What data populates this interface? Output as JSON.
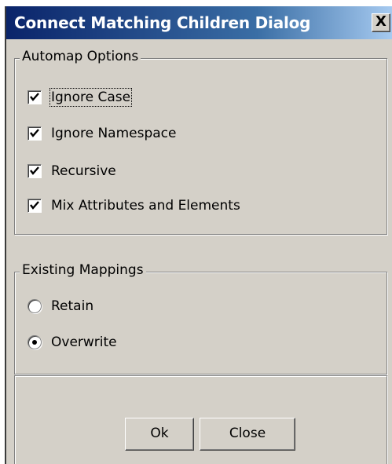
{
  "window": {
    "title": "Connect Matching Children Dialog",
    "close_glyph": "X"
  },
  "automap": {
    "legend": "Automap Options",
    "options": [
      {
        "label": "Ignore Case",
        "checked": true
      },
      {
        "label": "Ignore Namespace",
        "checked": true
      },
      {
        "label": "Recursive",
        "checked": true
      },
      {
        "label": "Mix Attributes and Elements",
        "checked": true
      }
    ]
  },
  "mappings": {
    "legend": "Existing Mappings",
    "options": [
      {
        "label": "Retain",
        "selected": false
      },
      {
        "label": "Overwrite",
        "selected": true
      }
    ]
  },
  "buttons": {
    "ok": "Ok",
    "close": "Close"
  }
}
